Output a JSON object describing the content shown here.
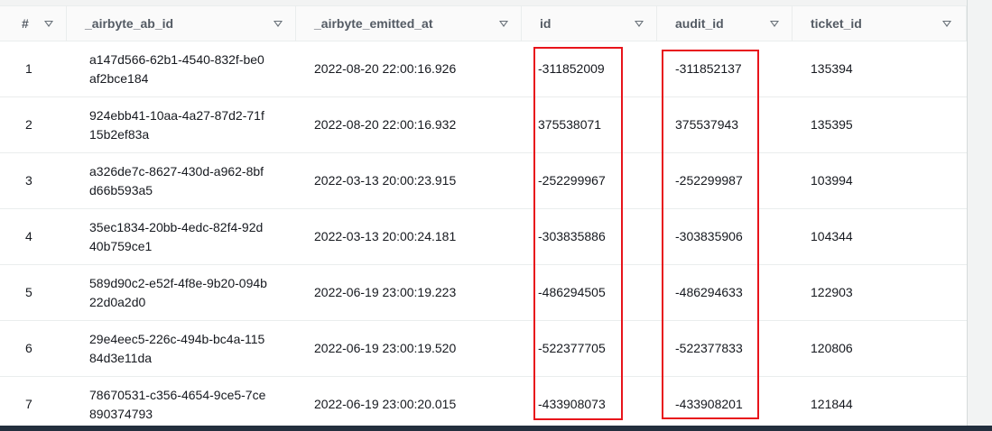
{
  "table": {
    "columns": [
      {
        "key": "num",
        "label": "#"
      },
      {
        "key": "airbyte_ab_id",
        "label": "_airbyte_ab_id"
      },
      {
        "key": "airbyte_emitted_at",
        "label": "_airbyte_emitted_at"
      },
      {
        "key": "id",
        "label": "id"
      },
      {
        "key": "audit_id",
        "label": "audit_id"
      },
      {
        "key": "ticket_id",
        "label": "ticket_id"
      }
    ],
    "rows": [
      {
        "num": "1",
        "airbyte_ab_id": "a147d566-62b1-4540-832f-be0af2bce184",
        "airbyte_emitted_at": "2022-08-20 22:00:16.926",
        "id": "-311852009",
        "audit_id": "-311852137",
        "ticket_id": "135394"
      },
      {
        "num": "2",
        "airbyte_ab_id": "924ebb41-10aa-4a27-87d2-71f15b2ef83a",
        "airbyte_emitted_at": "2022-08-20 22:00:16.932",
        "id": "375538071",
        "audit_id": "375537943",
        "ticket_id": "135395"
      },
      {
        "num": "3",
        "airbyte_ab_id": "a326de7c-8627-430d-a962-8bfd66b593a5",
        "airbyte_emitted_at": "2022-03-13 20:00:23.915",
        "id": "-252299967",
        "audit_id": "-252299987",
        "ticket_id": "103994"
      },
      {
        "num": "4",
        "airbyte_ab_id": "35ec1834-20bb-4edc-82f4-92d40b759ce1",
        "airbyte_emitted_at": "2022-03-13 20:00:24.181",
        "id": "-303835886",
        "audit_id": "-303835906",
        "ticket_id": "104344"
      },
      {
        "num": "5",
        "airbyte_ab_id": "589d90c2-e52f-4f8e-9b20-094b22d0a2d0",
        "airbyte_emitted_at": "2022-06-19 23:00:19.223",
        "id": "-486294505",
        "audit_id": "-486294633",
        "ticket_id": "122903"
      },
      {
        "num": "6",
        "airbyte_ab_id": "29e4eec5-226c-494b-bc4a-11584d3e11da",
        "airbyte_emitted_at": "2022-06-19 23:00:19.520",
        "id": "-522377705",
        "audit_id": "-522377833",
        "ticket_id": "120806"
      },
      {
        "num": "7",
        "airbyte_ab_id": "78670531-c356-4654-9ce5-7ce890374793",
        "airbyte_emitted_at": "2022-06-19 23:00:20.015",
        "id": "-433908073",
        "audit_id": "-433908201",
        "ticket_id": "121844"
      }
    ]
  },
  "icons": {
    "sort": "sort-caret-down-icon"
  },
  "colors": {
    "highlight": "#e8141b",
    "header_text": "#545b64",
    "cell_text": "#16191f"
  }
}
